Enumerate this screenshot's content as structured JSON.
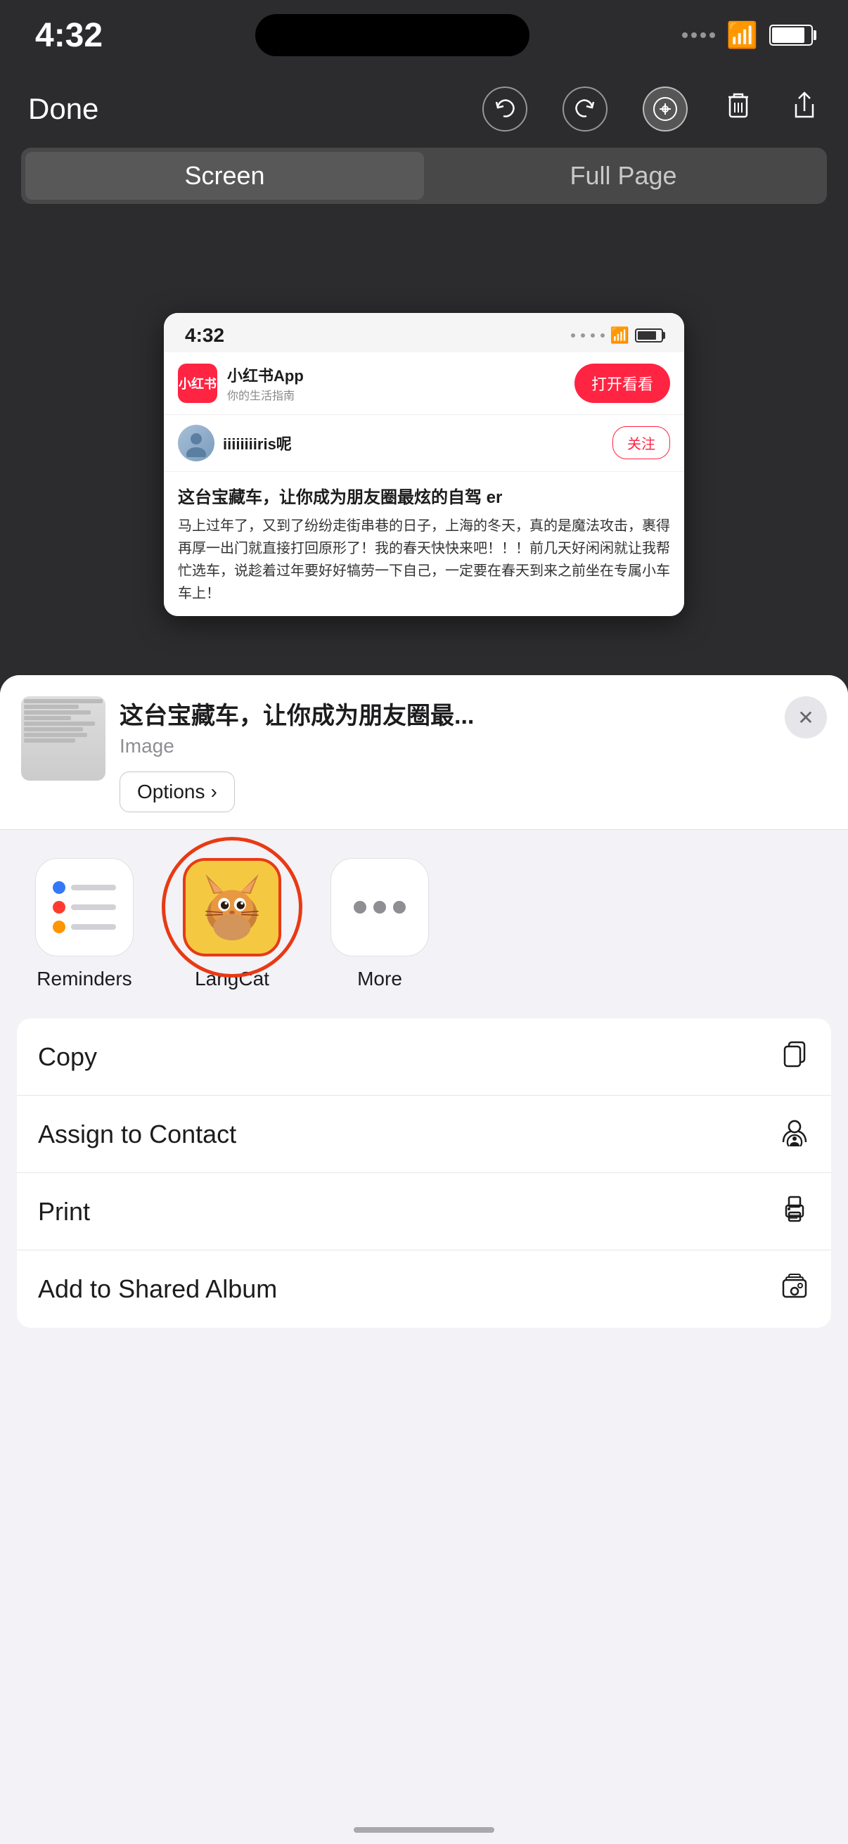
{
  "statusBar": {
    "time": "4:32",
    "batteryLevel": 85
  },
  "toolbar": {
    "done_label": "Done"
  },
  "segmentControl": {
    "screen_label": "Screen",
    "fullpage_label": "Full Page"
  },
  "screenshot": {
    "time": "4:32",
    "appName": "小红书App",
    "appSubtitle": "你的生活指南",
    "openBtn": "打开看看",
    "username": "iiiiiiiiris呢",
    "followBtn": "关注",
    "contentTitle": "这台宝藏车，让你成为朋友圈最炫的自驾 er",
    "contentText": "马上过年了，又到了纷纷走街串巷的日子，上海的冬天，真的是魔法攻击，裹得再厚一出门就直接打回原形了！我的春天快快来吧！！！前几天好闲闲就让我帮忙选车，说趁着过年要好好犒劳一下自己，一定要在春天到来之前坐在专属小车车上！"
  },
  "shareSheet": {
    "title": "这台宝藏车，让你成为朋友圈最...",
    "subtitle": "Image",
    "options_label": "Options",
    "close_label": "×"
  },
  "apps": [
    {
      "id": "reminders",
      "label": "Reminders",
      "highlighted": false
    },
    {
      "id": "langcat",
      "label": "LangCat",
      "highlighted": true
    },
    {
      "id": "more",
      "label": "More",
      "highlighted": false
    }
  ],
  "actions": [
    {
      "id": "copy",
      "label": "Copy",
      "icon": "copy"
    },
    {
      "id": "assign-contact",
      "label": "Assign to Contact",
      "icon": "person"
    },
    {
      "id": "print",
      "label": "Print",
      "icon": "printer"
    },
    {
      "id": "add-shared-album",
      "label": "Add to Shared Album",
      "icon": "album"
    }
  ]
}
